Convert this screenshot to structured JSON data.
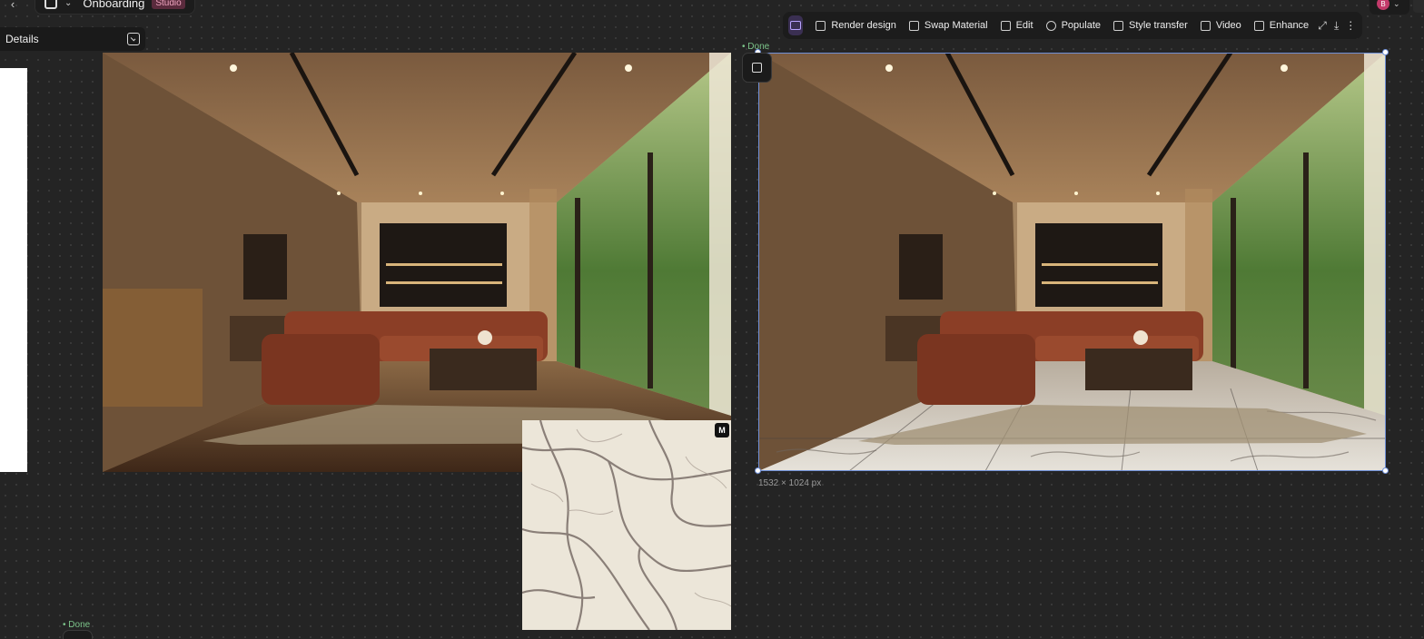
{
  "header": {
    "back_icon": "chevron-left-icon",
    "project_name": "Onboarding",
    "project_badge": "Studio"
  },
  "details_panel": {
    "title": "Details"
  },
  "toolbar": {
    "items": [
      {
        "label": "Render design",
        "icon": "render-icon"
      },
      {
        "label": "Swap Material",
        "icon": "swap-material-icon"
      },
      {
        "label": "Edit",
        "icon": "edit-icon"
      },
      {
        "label": "Populate",
        "icon": "populate-icon"
      },
      {
        "label": "Style transfer",
        "icon": "style-transfer-icon"
      },
      {
        "label": "Video",
        "icon": "video-icon"
      },
      {
        "label": "Enhance",
        "icon": "enhance-icon"
      }
    ]
  },
  "user": {
    "initial": "B"
  },
  "canvas": {
    "right_image_status": "• Done",
    "right_image_size": "1532 × 1024 px",
    "bottom_node_status": "• Done",
    "marble_badge": "M"
  },
  "colors": {
    "background": "#242424",
    "selection": "#6f8fd6",
    "status": "#7cc48a",
    "accent": "#b9a3ff"
  }
}
